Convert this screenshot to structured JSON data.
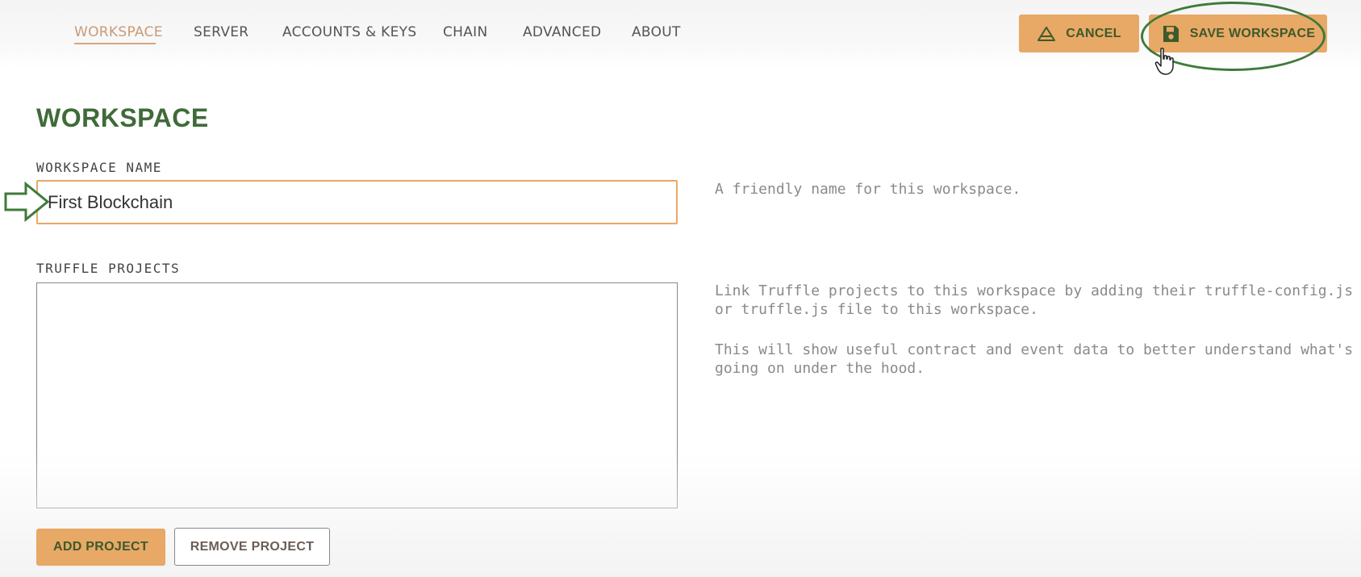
{
  "nav": {
    "items": [
      {
        "label": "WORKSPACE",
        "active": true
      },
      {
        "label": "SERVER",
        "active": false
      },
      {
        "label": "ACCOUNTS & KEYS",
        "active": false
      },
      {
        "label": "CHAIN",
        "active": false
      },
      {
        "label": "ADVANCED",
        "active": false
      },
      {
        "label": "ABOUT",
        "active": false
      }
    ]
  },
  "toolbar": {
    "cancel_label": "CANCEL",
    "save_label": "SAVE WORKSPACE"
  },
  "workspace": {
    "title": "WORKSPACE",
    "name_label": "WORKSPACE NAME",
    "name_value": "First Blockchain",
    "name_help": "A friendly name for this workspace.",
    "projects_label": "TRUFFLE PROJECTS",
    "projects_help_1": "Link Truffle projects to this workspace by adding their truffle-config.js or truffle.js file to this workspace.",
    "projects_help_2": "This will show useful contract and event data to better understand what's going on under the hood.",
    "add_project_label": "ADD PROJECT",
    "remove_project_label": "REMOVE PROJECT"
  },
  "colors": {
    "accent": "#e8a866",
    "title_green": "#3f6b38",
    "annotation_green": "#3f7a3a"
  }
}
